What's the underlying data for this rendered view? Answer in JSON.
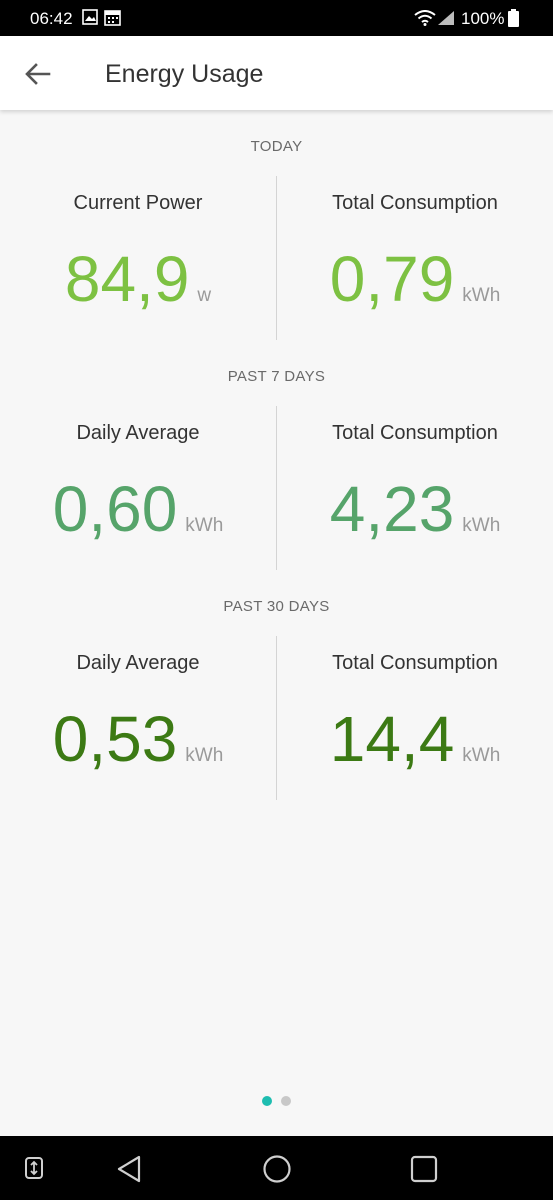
{
  "status_bar": {
    "time": "06:42",
    "battery": "100%"
  },
  "app_bar": {
    "title": "Energy Usage"
  },
  "colors": {
    "light_green": "#7dc142",
    "mid_green": "#56a46a",
    "dark_green": "#3c7a14",
    "accent": "#1ebdb0"
  },
  "sections": [
    {
      "header": "TODAY",
      "left": {
        "label": "Current Power",
        "value": "84,9",
        "unit": "w"
      },
      "right": {
        "label": "Total Consumption",
        "value": "0,79",
        "unit": "kWh"
      }
    },
    {
      "header": "PAST 7 DAYS",
      "left": {
        "label": "Daily Average",
        "value": "0,60",
        "unit": "kWh"
      },
      "right": {
        "label": "Total Consumption",
        "value": "4,23",
        "unit": "kWh"
      }
    },
    {
      "header": "PAST 30 DAYS",
      "left": {
        "label": "Daily Average",
        "value": "0,53",
        "unit": "kWh"
      },
      "right": {
        "label": "Total Consumption",
        "value": "14,4",
        "unit": "kWh"
      }
    }
  ],
  "page_indicator": {
    "total": 2,
    "active": 1
  },
  "icons": {
    "status": [
      "gallery-icon",
      "calendar-icon",
      "wifi-icon",
      "signal-icon",
      "battery-icon"
    ],
    "app_bar": [
      "back-arrow-icon"
    ],
    "nav": [
      "accessibility-icon",
      "back-triangle-icon",
      "home-circle-icon",
      "recents-square-icon"
    ]
  }
}
